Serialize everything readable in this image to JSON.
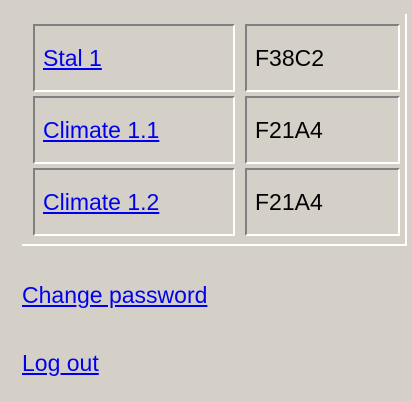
{
  "stations": [
    {
      "name": "Stal 1",
      "code": "F38C2"
    },
    {
      "name": "Climate 1.1",
      "code": "F21A4"
    },
    {
      "name": "Climate 1.2",
      "code": "F21A4"
    }
  ],
  "links": {
    "change_password": "Change password",
    "log_out": "Log out"
  },
  "colors": {
    "background": "#d4d0c8",
    "link": "#0000ee"
  }
}
